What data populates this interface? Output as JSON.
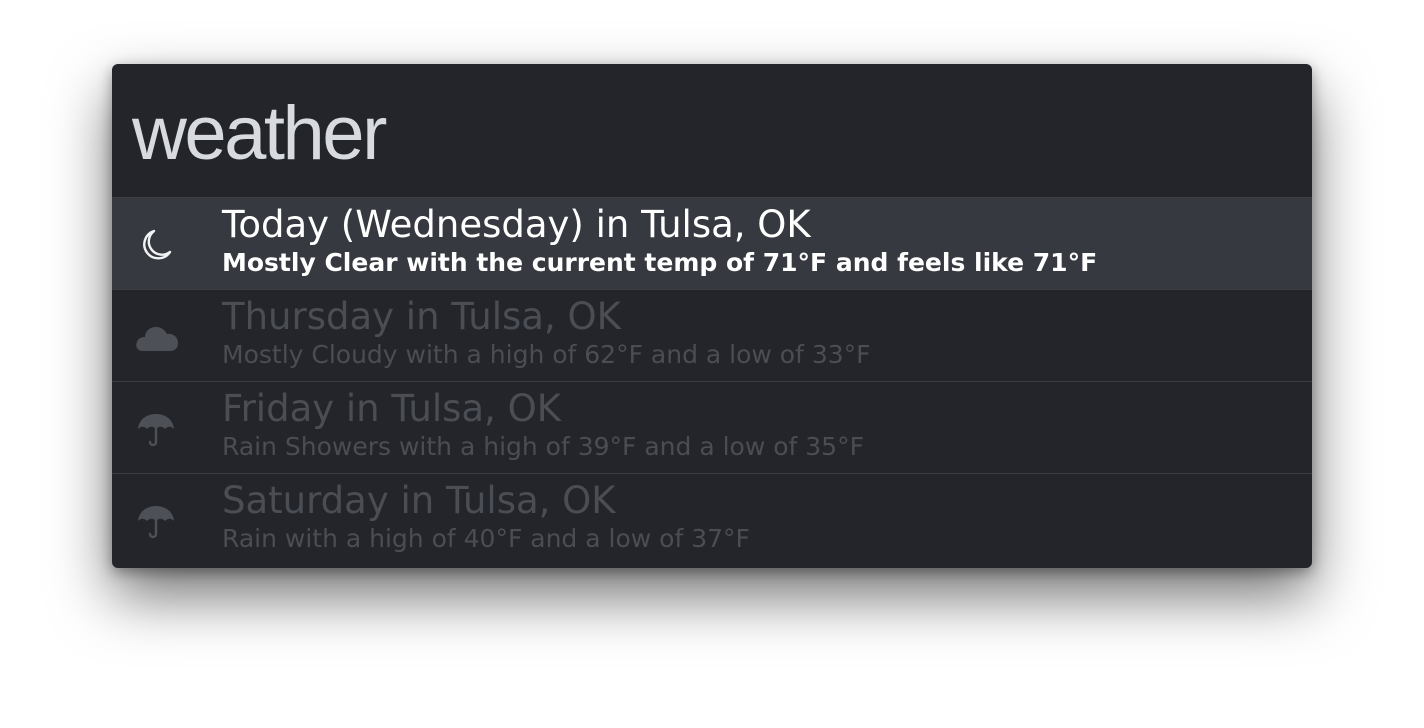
{
  "search": {
    "query": "weather"
  },
  "results": [
    {
      "icon": "moon-icon",
      "title": "Today (Wednesday) in Tulsa, OK",
      "subtitle": "Mostly Clear with the current temp of 71°F and feels like 71°F",
      "selected": true
    },
    {
      "icon": "cloud-icon",
      "title": "Thursday in Tulsa, OK",
      "subtitle": "Mostly Cloudy with a high of 62°F and a low of 33°F",
      "selected": false
    },
    {
      "icon": "umbrella-icon",
      "title": "Friday in Tulsa, OK",
      "subtitle": "Rain Showers with a high of 39°F and a low of 35°F",
      "selected": false
    },
    {
      "icon": "umbrella-icon",
      "title": "Saturday in Tulsa, OK",
      "subtitle": "Rain with a high of 40°F and a low of 37°F",
      "selected": false
    }
  ],
  "colors": {
    "panel_background": "#23252a",
    "selected_row": "#363940",
    "divider": "#3a3d43",
    "query_text": "#d7dade",
    "dim_text": "#4a4d53",
    "selected_text": "#ffffff"
  }
}
